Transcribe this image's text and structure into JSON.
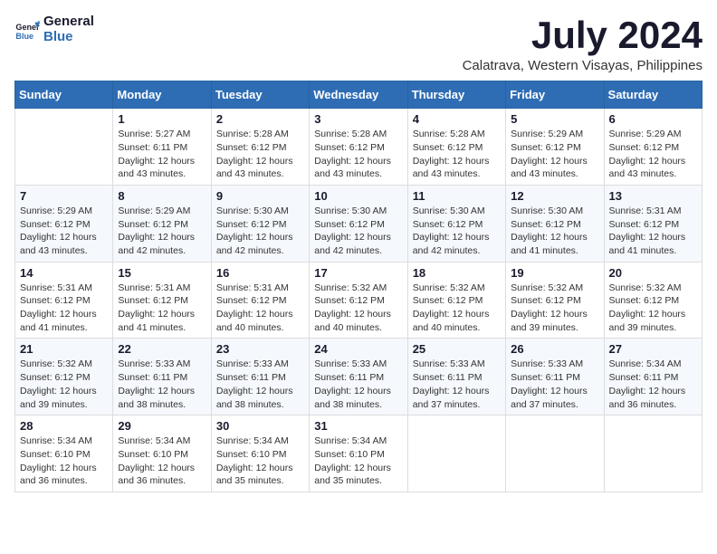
{
  "header": {
    "logo_line1": "General",
    "logo_line2": "Blue",
    "month_year": "July 2024",
    "location": "Calatrava, Western Visayas, Philippines"
  },
  "days_of_week": [
    "Sunday",
    "Monday",
    "Tuesday",
    "Wednesday",
    "Thursday",
    "Friday",
    "Saturday"
  ],
  "weeks": [
    [
      {
        "day": "",
        "sunrise": "",
        "sunset": "",
        "daylight": ""
      },
      {
        "day": "1",
        "sunrise": "5:27 AM",
        "sunset": "6:11 PM",
        "daylight": "12 hours and 43 minutes."
      },
      {
        "day": "2",
        "sunrise": "5:28 AM",
        "sunset": "6:12 PM",
        "daylight": "12 hours and 43 minutes."
      },
      {
        "day": "3",
        "sunrise": "5:28 AM",
        "sunset": "6:12 PM",
        "daylight": "12 hours and 43 minutes."
      },
      {
        "day": "4",
        "sunrise": "5:28 AM",
        "sunset": "6:12 PM",
        "daylight": "12 hours and 43 minutes."
      },
      {
        "day": "5",
        "sunrise": "5:29 AM",
        "sunset": "6:12 PM",
        "daylight": "12 hours and 43 minutes."
      },
      {
        "day": "6",
        "sunrise": "5:29 AM",
        "sunset": "6:12 PM",
        "daylight": "12 hours and 43 minutes."
      }
    ],
    [
      {
        "day": "7",
        "sunrise": "5:29 AM",
        "sunset": "6:12 PM",
        "daylight": "12 hours and 43 minutes."
      },
      {
        "day": "8",
        "sunrise": "5:29 AM",
        "sunset": "6:12 PM",
        "daylight": "12 hours and 42 minutes."
      },
      {
        "day": "9",
        "sunrise": "5:30 AM",
        "sunset": "6:12 PM",
        "daylight": "12 hours and 42 minutes."
      },
      {
        "day": "10",
        "sunrise": "5:30 AM",
        "sunset": "6:12 PM",
        "daylight": "12 hours and 42 minutes."
      },
      {
        "day": "11",
        "sunrise": "5:30 AM",
        "sunset": "6:12 PM",
        "daylight": "12 hours and 42 minutes."
      },
      {
        "day": "12",
        "sunrise": "5:30 AM",
        "sunset": "6:12 PM",
        "daylight": "12 hours and 41 minutes."
      },
      {
        "day": "13",
        "sunrise": "5:31 AM",
        "sunset": "6:12 PM",
        "daylight": "12 hours and 41 minutes."
      }
    ],
    [
      {
        "day": "14",
        "sunrise": "5:31 AM",
        "sunset": "6:12 PM",
        "daylight": "12 hours and 41 minutes."
      },
      {
        "day": "15",
        "sunrise": "5:31 AM",
        "sunset": "6:12 PM",
        "daylight": "12 hours and 41 minutes."
      },
      {
        "day": "16",
        "sunrise": "5:31 AM",
        "sunset": "6:12 PM",
        "daylight": "12 hours and 40 minutes."
      },
      {
        "day": "17",
        "sunrise": "5:32 AM",
        "sunset": "6:12 PM",
        "daylight": "12 hours and 40 minutes."
      },
      {
        "day": "18",
        "sunrise": "5:32 AM",
        "sunset": "6:12 PM",
        "daylight": "12 hours and 40 minutes."
      },
      {
        "day": "19",
        "sunrise": "5:32 AM",
        "sunset": "6:12 PM",
        "daylight": "12 hours and 39 minutes."
      },
      {
        "day": "20",
        "sunrise": "5:32 AM",
        "sunset": "6:12 PM",
        "daylight": "12 hours and 39 minutes."
      }
    ],
    [
      {
        "day": "21",
        "sunrise": "5:32 AM",
        "sunset": "6:12 PM",
        "daylight": "12 hours and 39 minutes."
      },
      {
        "day": "22",
        "sunrise": "5:33 AM",
        "sunset": "6:11 PM",
        "daylight": "12 hours and 38 minutes."
      },
      {
        "day": "23",
        "sunrise": "5:33 AM",
        "sunset": "6:11 PM",
        "daylight": "12 hours and 38 minutes."
      },
      {
        "day": "24",
        "sunrise": "5:33 AM",
        "sunset": "6:11 PM",
        "daylight": "12 hours and 38 minutes."
      },
      {
        "day": "25",
        "sunrise": "5:33 AM",
        "sunset": "6:11 PM",
        "daylight": "12 hours and 37 minutes."
      },
      {
        "day": "26",
        "sunrise": "5:33 AM",
        "sunset": "6:11 PM",
        "daylight": "12 hours and 37 minutes."
      },
      {
        "day": "27",
        "sunrise": "5:34 AM",
        "sunset": "6:11 PM",
        "daylight": "12 hours and 36 minutes."
      }
    ],
    [
      {
        "day": "28",
        "sunrise": "5:34 AM",
        "sunset": "6:10 PM",
        "daylight": "12 hours and 36 minutes."
      },
      {
        "day": "29",
        "sunrise": "5:34 AM",
        "sunset": "6:10 PM",
        "daylight": "12 hours and 36 minutes."
      },
      {
        "day": "30",
        "sunrise": "5:34 AM",
        "sunset": "6:10 PM",
        "daylight": "12 hours and 35 minutes."
      },
      {
        "day": "31",
        "sunrise": "5:34 AM",
        "sunset": "6:10 PM",
        "daylight": "12 hours and 35 minutes."
      },
      {
        "day": "",
        "sunrise": "",
        "sunset": "",
        "daylight": ""
      },
      {
        "day": "",
        "sunrise": "",
        "sunset": "",
        "daylight": ""
      },
      {
        "day": "",
        "sunrise": "",
        "sunset": "",
        "daylight": ""
      }
    ]
  ]
}
